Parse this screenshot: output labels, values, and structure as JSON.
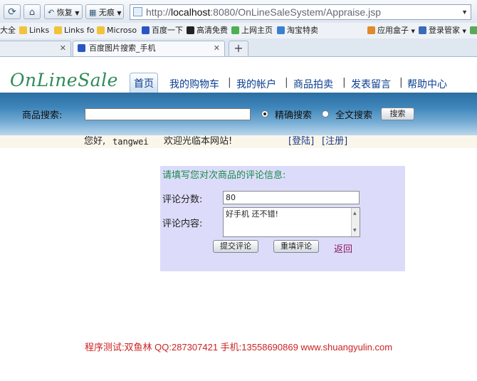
{
  "browser": {
    "back_label": "恢复",
    "privacy_label": "无痕",
    "address": {
      "prefix": "http://",
      "host": "localhost",
      "rest": ":8080/OnLineSaleSystem/Appraise.jsp"
    }
  },
  "bookmarks": [
    {
      "label": "大全"
    },
    {
      "label": "Links"
    },
    {
      "label": "Links fo"
    },
    {
      "label": "Microso"
    },
    {
      "label": "百度一下"
    },
    {
      "label": "高清免费"
    },
    {
      "label": "上网主页"
    },
    {
      "label": "淘宝特卖"
    },
    {
      "label": "应用盒子"
    },
    {
      "label": "登录管家"
    }
  ],
  "tabs": [
    {
      "label": "百度图片搜索_手机"
    }
  ],
  "site": {
    "logo": "OnLineSale",
    "nav": [
      {
        "label": "首页"
      },
      {
        "label": "我的购物车"
      },
      {
        "label": "我的帐户"
      },
      {
        "label": "商品拍卖"
      },
      {
        "label": "发表留言"
      },
      {
        "label": "帮助中心"
      }
    ],
    "search": {
      "label": "商品搜索:",
      "option_exact": "精确搜索",
      "option_full": "全文搜索",
      "button": "搜索"
    },
    "welcome": {
      "greeting": "您好,",
      "username": "tangwei",
      "message": "欢迎光临本网站!",
      "login": "[登陆]",
      "register": "[注册]"
    }
  },
  "form": {
    "title": "请填写您对次商品的评论信息:",
    "score_label": "评论分数:",
    "score_value": "80",
    "content_label": "评论内容:",
    "content_value": "好手机 还不错!",
    "submit": "提交评论",
    "reset": "重填评论",
    "back": "返回"
  },
  "footer": "程序测试:双鱼林 QQ:287307421 手机:13558690869 www.shuangyulin.com",
  "colors": {
    "logo": "#2e8b57",
    "nav": "#0a3d8f",
    "form_bg": "#dcdcfa",
    "footer": "#cc2222"
  }
}
